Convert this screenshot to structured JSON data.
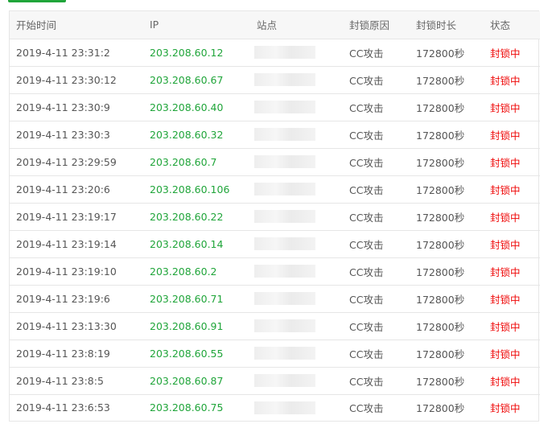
{
  "columns": {
    "start_time": "开始时间",
    "ip": "IP",
    "site": "站点",
    "reason": "封锁原因",
    "duration": "封锁时长",
    "status": "状态"
  },
  "rows": [
    {
      "start_time": "2019-4-11 23:31:2",
      "ip": "203.208.60.12",
      "site": "",
      "reason": "CC攻击",
      "duration": "172800秒",
      "status": "封锁中"
    },
    {
      "start_time": "2019-4-11 23:30:12",
      "ip": "203.208.60.67",
      "site": "",
      "reason": "CC攻击",
      "duration": "172800秒",
      "status": "封锁中"
    },
    {
      "start_time": "2019-4-11 23:30:9",
      "ip": "203.208.60.40",
      "site": "",
      "reason": "CC攻击",
      "duration": "172800秒",
      "status": "封锁中"
    },
    {
      "start_time": "2019-4-11 23:30:3",
      "ip": "203.208.60.32",
      "site": "",
      "reason": "CC攻击",
      "duration": "172800秒",
      "status": "封锁中"
    },
    {
      "start_time": "2019-4-11 23:29:59",
      "ip": "203.208.60.7",
      "site": "",
      "reason": "CC攻击",
      "duration": "172800秒",
      "status": "封锁中"
    },
    {
      "start_time": "2019-4-11 23:20:6",
      "ip": "203.208.60.106",
      "site": "",
      "reason": "CC攻击",
      "duration": "172800秒",
      "status": "封锁中"
    },
    {
      "start_time": "2019-4-11 23:19:17",
      "ip": "203.208.60.22",
      "site": "",
      "reason": "CC攻击",
      "duration": "172800秒",
      "status": "封锁中"
    },
    {
      "start_time": "2019-4-11 23:19:14",
      "ip": "203.208.60.14",
      "site": "",
      "reason": "CC攻击",
      "duration": "172800秒",
      "status": "封锁中"
    },
    {
      "start_time": "2019-4-11 23:19:10",
      "ip": "203.208.60.2",
      "site": "",
      "reason": "CC攻击",
      "duration": "172800秒",
      "status": "封锁中"
    },
    {
      "start_time": "2019-4-11 23:19:6",
      "ip": "203.208.60.71",
      "site": "",
      "reason": "CC攻击",
      "duration": "172800秒",
      "status": "封锁中"
    },
    {
      "start_time": "2019-4-11 23:13:30",
      "ip": "203.208.60.91",
      "site": "",
      "reason": "CC攻击",
      "duration": "172800秒",
      "status": "封锁中"
    },
    {
      "start_time": "2019-4-11 23:8:19",
      "ip": "203.208.60.55",
      "site": "",
      "reason": "CC攻击",
      "duration": "172800秒",
      "status": "封锁中"
    },
    {
      "start_time": "2019-4-11 23:8:5",
      "ip": "203.208.60.87",
      "site": "",
      "reason": "CC攻击",
      "duration": "172800秒",
      "status": "封锁中"
    },
    {
      "start_time": "2019-4-11 23:6:53",
      "ip": "203.208.60.75",
      "site": "",
      "reason": "CC攻击",
      "duration": "172800秒",
      "status": "封锁中"
    }
  ],
  "colors": {
    "accent": "#20a53a",
    "status_blocked": "#ef0808",
    "header_bg": "#f7f7f7",
    "border": "#e6e6e6"
  }
}
